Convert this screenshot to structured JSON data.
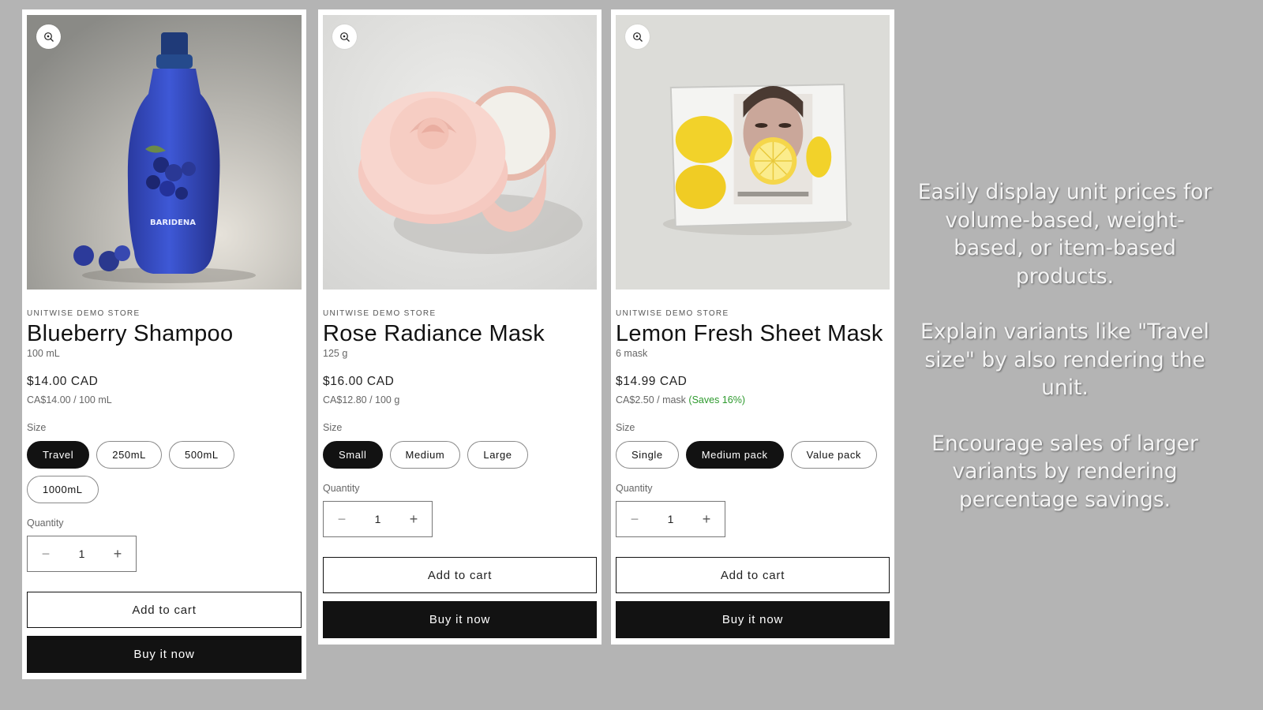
{
  "products": [
    {
      "vendor": "UNITWISE DEMO STORE",
      "title": "Blueberry Shampoo",
      "unit_size": "100 mL",
      "price": "$14.00 CAD",
      "unit_price": "CA$14.00 / 100 mL",
      "savings": "",
      "option_label": "Size",
      "options": [
        "Travel",
        "250mL",
        "500mL",
        "1000mL"
      ],
      "selected_option": "Travel",
      "quantity_label": "Quantity",
      "quantity": "1",
      "add_to_cart": "Add to cart",
      "buy_now": "Buy it now",
      "image": "blueberry-shampoo-bottle",
      "bottle_label": "BARIDENA"
    },
    {
      "vendor": "UNITWISE DEMO STORE",
      "title": "Rose Radiance Mask",
      "unit_size": "125 g",
      "price": "$16.00 CAD",
      "unit_price": "CA$12.80 / 100 g",
      "savings": "",
      "option_label": "Size",
      "options": [
        "Small",
        "Medium",
        "Large"
      ],
      "selected_option": "Small",
      "quantity_label": "Quantity",
      "quantity": "1",
      "add_to_cart": "Add to cart",
      "buy_now": "Buy it now",
      "image": "rose-cream-jar"
    },
    {
      "vendor": "UNITWISE DEMO STORE",
      "title": "Lemon Fresh Sheet Mask",
      "unit_size": "6 mask",
      "price": "$14.99 CAD",
      "unit_price": "CA$2.50 / mask",
      "savings": "(Saves 16%)",
      "option_label": "Size",
      "options": [
        "Single",
        "Medium pack",
        "Value pack"
      ],
      "selected_option": "Medium pack",
      "quantity_label": "Quantity",
      "quantity": "1",
      "add_to_cart": "Add to cart",
      "buy_now": "Buy it now",
      "image": "lemon-sheet-mask-pouch"
    }
  ],
  "marketing": [
    "Easily display unit prices for volume-based, weight-based, or item-based products.",
    "Explain variants like \"Travel size\" by also rendering the unit.",
    "Encourage sales of larger variants by rendering percentage savings."
  ],
  "colors": {
    "background": "#b4b4b4",
    "selected_pill": "#121212",
    "buy_button": "#121212",
    "savings": "#2e9a2e"
  },
  "icons": {
    "zoom": "zoom-in-icon",
    "minus": "minus-icon",
    "plus": "plus-icon"
  },
  "qty_symbols": {
    "minus": "−",
    "plus": "+"
  }
}
